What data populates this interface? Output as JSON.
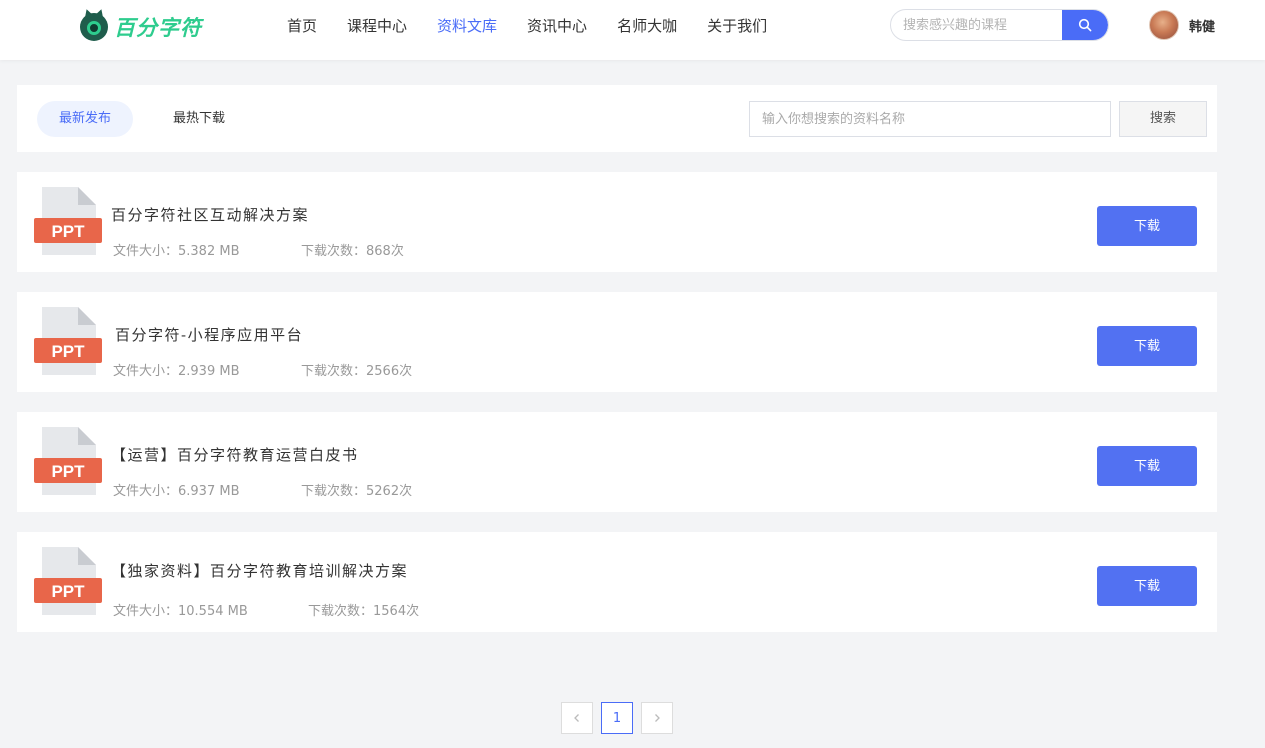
{
  "brand": {
    "name": "百分字符",
    "color": "#2ecc8e",
    "icon": "cat-logo-icon"
  },
  "nav": {
    "items": [
      {
        "label": "首页",
        "active": false
      },
      {
        "label": "课程中心",
        "active": false
      },
      {
        "label": "资料文库",
        "active": true
      },
      {
        "label": "资讯中心",
        "active": false
      },
      {
        "label": "名师大咖",
        "active": false
      },
      {
        "label": "关于我们",
        "active": false
      }
    ],
    "accent": "#4a6cf7"
  },
  "course_search": {
    "placeholder": "搜索感兴趣的课程",
    "icon": "search-icon"
  },
  "user": {
    "name": "韩健",
    "avatar": "avatar-photo"
  },
  "filter": {
    "tabs": [
      {
        "label": "最新发布",
        "active": true
      },
      {
        "label": "最热下载",
        "active": false
      }
    ],
    "search_placeholder": "输入你想搜索的资料名称",
    "search_button": "搜索"
  },
  "resources": [
    {
      "type": "PPT",
      "title": "百分字符社区互动解决方案",
      "size": "文件大小：5.382 MB",
      "downloads": "下载次数：868次",
      "button": "下载"
    },
    {
      "type": "PPT",
      "title": "百分字符-小程序应用平台",
      "size": "文件大小：2.939 MB",
      "downloads": "下载次数：2566次",
      "button": "下载"
    },
    {
      "type": "PPT",
      "title": "【运营】百分字符教育运营白皮书",
      "size": "文件大小：6.937 MB",
      "downloads": "下载次数：5262次",
      "button": "下载"
    },
    {
      "type": "PPT",
      "title": "【独家资料】百分字符教育培训解决方案",
      "size": "文件大小：10.554 MB",
      "downloads": "下载次数：1564次",
      "button": "下载"
    }
  ],
  "pagination": {
    "prev_icon": "chevron-left-icon",
    "current_page": "1",
    "next_icon": "chevron-right-icon"
  },
  "colors": {
    "ppt_badge": "#e8664a",
    "download_button": "#5271f2",
    "page_background": "#f3f4f6"
  }
}
